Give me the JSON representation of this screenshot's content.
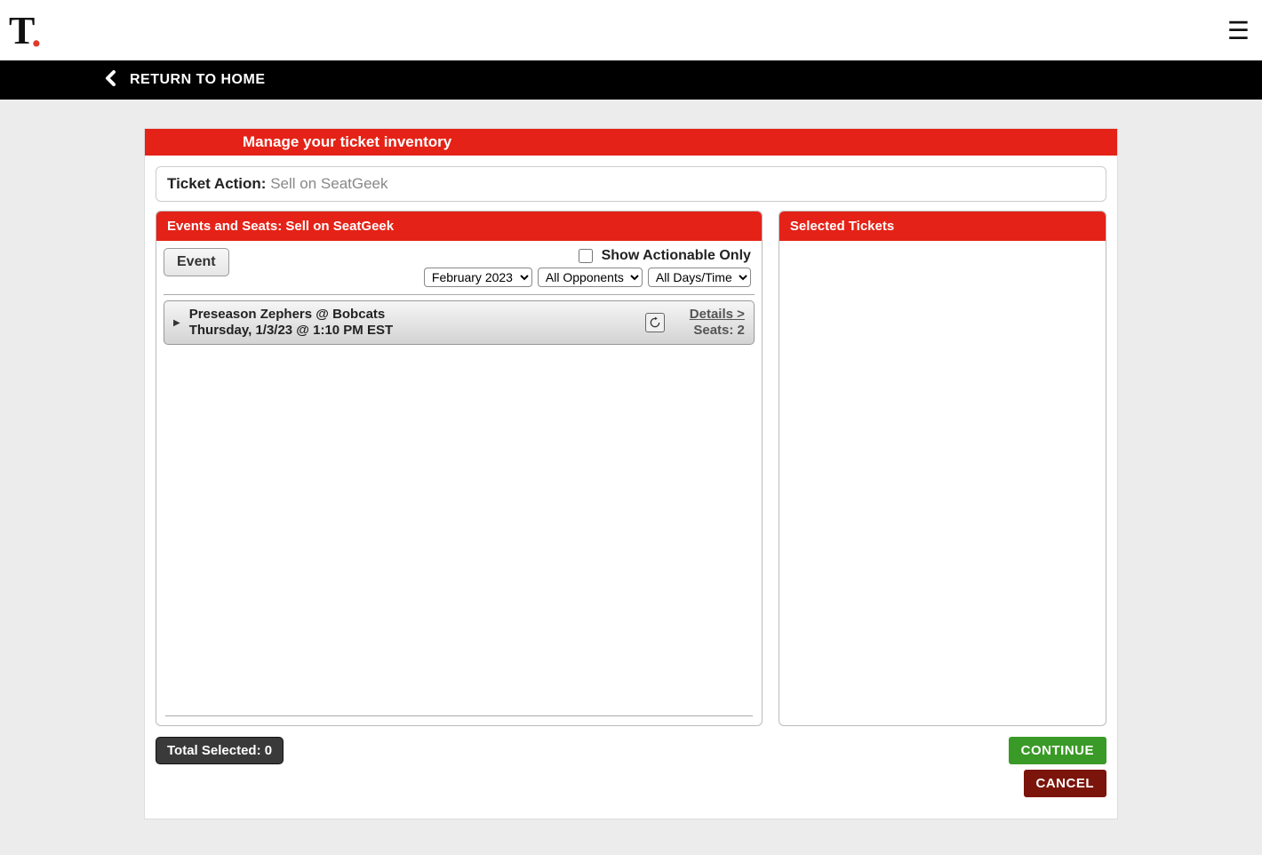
{
  "header": {
    "logo_text": "T",
    "logo_dot": "."
  },
  "nav": {
    "return_label": "RETURN TO HOME"
  },
  "page": {
    "title": "Manage your ticket inventory",
    "ticket_action_label": "Ticket Action:",
    "ticket_action_value": "Sell on SeatGeek"
  },
  "left_panel": {
    "header": "Events and Seats: Sell on SeatGeek",
    "event_button": "Event",
    "actionable_label": "Show Actionable Only",
    "month_select": "February 2023",
    "opponent_select": "All Opponents",
    "daytime_select": "All Days/Time",
    "events": [
      {
        "title": "Preseason Zephers @ Bobcats",
        "datetime": "Thursday, 1/3/23 @ 1:10 PM EST",
        "details_label": "Details >",
        "seats_label": "Seats: 2"
      }
    ]
  },
  "right_panel": {
    "header": "Selected Tickets"
  },
  "footer": {
    "total_selected": "Total Selected: 0",
    "continue": "CONTINUE",
    "cancel": "CANCEL"
  }
}
